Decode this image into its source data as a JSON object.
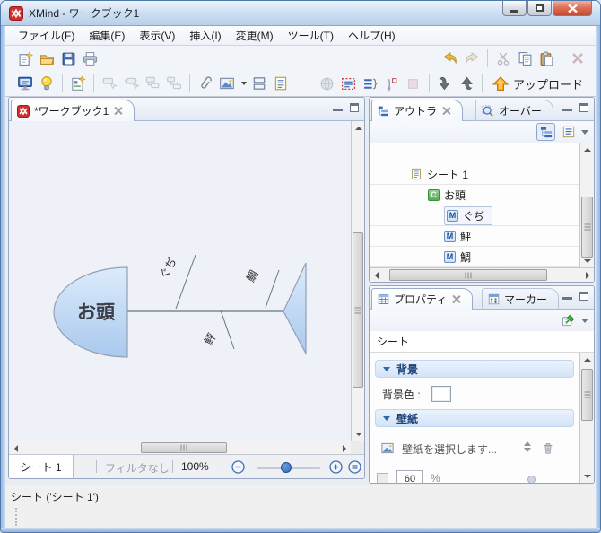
{
  "colors": {
    "titlebar_blue": "#cfe0f3",
    "close_red": "#c44a33",
    "accent_blue": "#2f6fc1",
    "upload_orange": "#f9a51a",
    "canvas_bg": "#eef1f8",
    "fish_fill_top": "#dcebfb",
    "fish_fill_bottom": "#a9c9ee",
    "badge_green": "#57ab57"
  },
  "window": {
    "title": "XMind - ワークブック1"
  },
  "menu": {
    "items": [
      "ファイル(F)",
      "編集(E)",
      "表示(V)",
      "挿入(I)",
      "変更(M)",
      "ツール(T)",
      "ヘルプ(H)"
    ]
  },
  "toolbar": {
    "upload_label": "アップロード"
  },
  "editor": {
    "tab_title": "*ワークブック1",
    "sheet_tab": "シート 1",
    "filter_label": "フィルタなし",
    "zoom_level": "100%"
  },
  "fishbone": {
    "head": "お頭",
    "bones": [
      "ぐぢ",
      "鯛",
      "鮃"
    ]
  },
  "outline": {
    "tab_outline": "アウトラ",
    "tab_overview": "オーバー",
    "items": [
      {
        "label": "シート 1",
        "badge": ""
      },
      {
        "label": "お頭",
        "badge": "C"
      },
      {
        "label": "ぐぢ",
        "badge": "M"
      },
      {
        "label": "鮃",
        "badge": "M"
      },
      {
        "label": "鯛",
        "badge": "M"
      }
    ]
  },
  "properties": {
    "tab_properties": "プロパティ",
    "tab_marker": "マーカー",
    "target_label": "シート",
    "background_title": "背景",
    "background_color_label": "背景色 :",
    "wallpaper_title": "壁紙",
    "wallpaper_select_label": "壁紙を選択します...",
    "opacity_value": "60",
    "opacity_unit": "%"
  },
  "statusbar": {
    "text": "シート ('シート 1')"
  }
}
